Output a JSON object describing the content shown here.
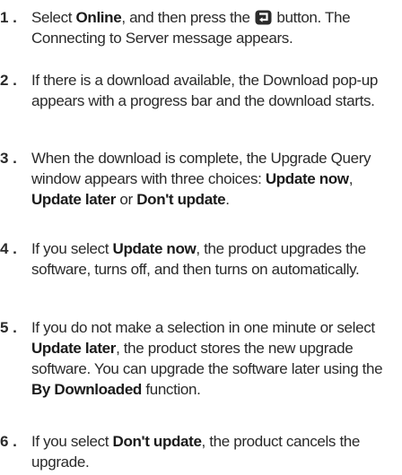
{
  "steps": [
    {
      "number": "1 .",
      "parts": [
        {
          "t": "Select "
        },
        {
          "t": "Online",
          "b": true
        },
        {
          "t": ", and then press the "
        },
        {
          "icon": "enter-button-icon"
        },
        {
          "t": " button. The Connecting to Server message appears."
        }
      ]
    },
    {
      "number": "2 .",
      "parts": [
        {
          "t": "If there is a download available, the Download pop-up appears with a progress bar and the download starts."
        }
      ]
    },
    {
      "number": "3 .",
      "parts": [
        {
          "t": "When the download is complete, the Upgrade Query window appears with three choices: "
        },
        {
          "t": "Update now",
          "b": true
        },
        {
          "t": ", "
        },
        {
          "t": "Update later",
          "b": true
        },
        {
          "t": " or "
        },
        {
          "t": "Don't update",
          "b": true
        },
        {
          "t": "."
        }
      ]
    },
    {
      "number": "4 .",
      "parts": [
        {
          "t": "If you select "
        },
        {
          "t": "Update now",
          "b": true
        },
        {
          "t": ", the product upgrades the software, turns off, and then turns on automatically."
        }
      ]
    },
    {
      "number": "5 .",
      "parts": [
        {
          "t": "If you do not make a selection in one minute or select "
        },
        {
          "t": "Update later",
          "b": true
        },
        {
          "t": ", the product stores the new upgrade software. You can upgrade the software later using the "
        },
        {
          "t": "By Downloaded",
          "b": true
        },
        {
          "t": " function."
        }
      ]
    },
    {
      "number": "6 .",
      "parts": [
        {
          "t": "If you select "
        },
        {
          "t": "Don't update",
          "b": true
        },
        {
          "t": ", the product cancels the upgrade."
        }
      ]
    }
  ]
}
